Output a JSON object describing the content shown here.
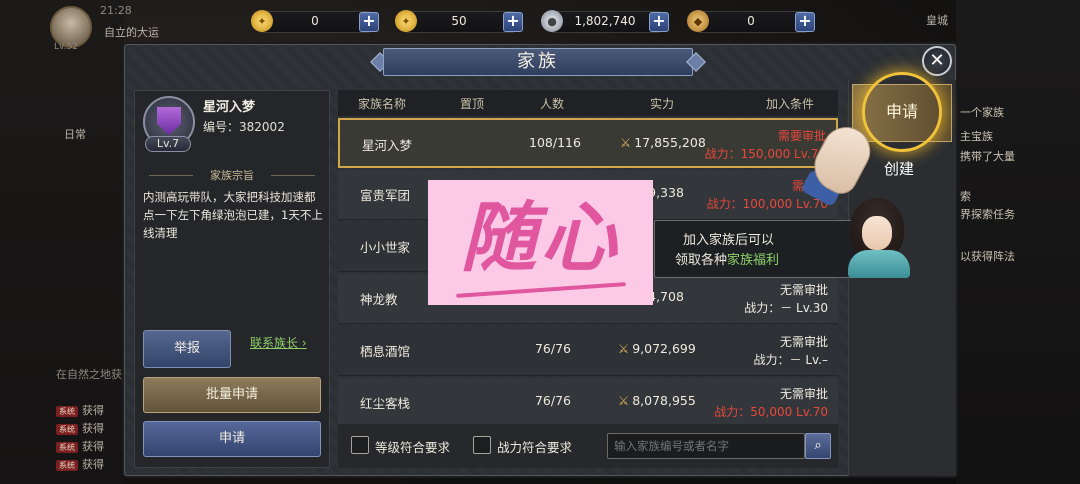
{
  "background": {
    "time": "21:28",
    "region": "皇城",
    "left_tag": "自立的大运",
    "daily_label": "日常",
    "lv_small": "Lv.52",
    "chat_title": "在自然之地获",
    "chat_lines": [
      "获得",
      "获得",
      "获得",
      "获得"
    ],
    "right_lines": [
      "一个家族",
      "主宝族",
      "携带了大量",
      "索",
      "界探索任务",
      "以获得阵法"
    ]
  },
  "currencies": [
    {
      "icon": "gold-coin-icon",
      "value": "0",
      "color": "#e3b02c"
    },
    {
      "icon": "gold-lock-coin-icon",
      "value": "50",
      "color": "#e3b02c"
    },
    {
      "icon": "silver-coin-icon",
      "value": "1,802,740",
      "color": "#a7adb7"
    },
    {
      "icon": "honor-token-icon",
      "value": "0",
      "color": "#d7a352"
    }
  ],
  "panel": {
    "title": "家族",
    "close_label": "✕"
  },
  "my_family": {
    "name": "星河入梦",
    "id_label": "编号：",
    "id": "382002",
    "level": "Lv.7",
    "motto_header": "家族宗旨",
    "motto": "内测高玩带队，大家把科技加速都点一下左下角绿泡泡已建，1天不上线清理",
    "report_label": "举报",
    "contact_label": "联系族长",
    "batch_apply_label": "批量申请",
    "apply_label": "申请"
  },
  "table": {
    "headers": [
      "家族名称",
      "置顶",
      "人数",
      "实力",
      "加入条件"
    ],
    "rows": [
      {
        "name": "星河入梦",
        "count": "108/116",
        "power": "17,855,208",
        "req1": "需要审批",
        "req2": "战力：150,000  Lv.70",
        "req_color": "red"
      },
      {
        "name": "富贵军团",
        "count": "",
        "power": "909,338",
        "req1": "需要审",
        "req2": "战力：100,000  Lv.70",
        "req_color": "red"
      },
      {
        "name": "小小世家",
        "count": "",
        "power": "",
        "req1": "",
        "req2": "",
        "req_color": "white"
      },
      {
        "name": "神龙教",
        "count": "",
        "power": "544,708",
        "req1": "无需审批",
        "req2": "战力：－  Lv.30",
        "req_color": "white"
      },
      {
        "name": "栖息酒馆",
        "count": "76/76",
        "power": "9,072,699",
        "req1": "无需审批",
        "req2": "战力：－  Lv.–",
        "req_color": "white"
      },
      {
        "name": "红尘客栈",
        "count": "76/76",
        "power": "8,078,955",
        "req1": "无需审批",
        "req2": "战力：50,000  Lv.70",
        "req_color": "red"
      }
    ]
  },
  "filters": {
    "level_match": "等级符合要求",
    "power_match": "战力符合要求",
    "search_placeholder": "输入家族编号或者名字"
  },
  "side": {
    "apply_tab": "申请",
    "create_tab": "创建",
    "tip_line1": "加入家族后可以",
    "tip_line2_prefix": "领取各种",
    "tip_line2_highlight": "家族福利"
  },
  "overlay": {
    "text": "随心"
  }
}
